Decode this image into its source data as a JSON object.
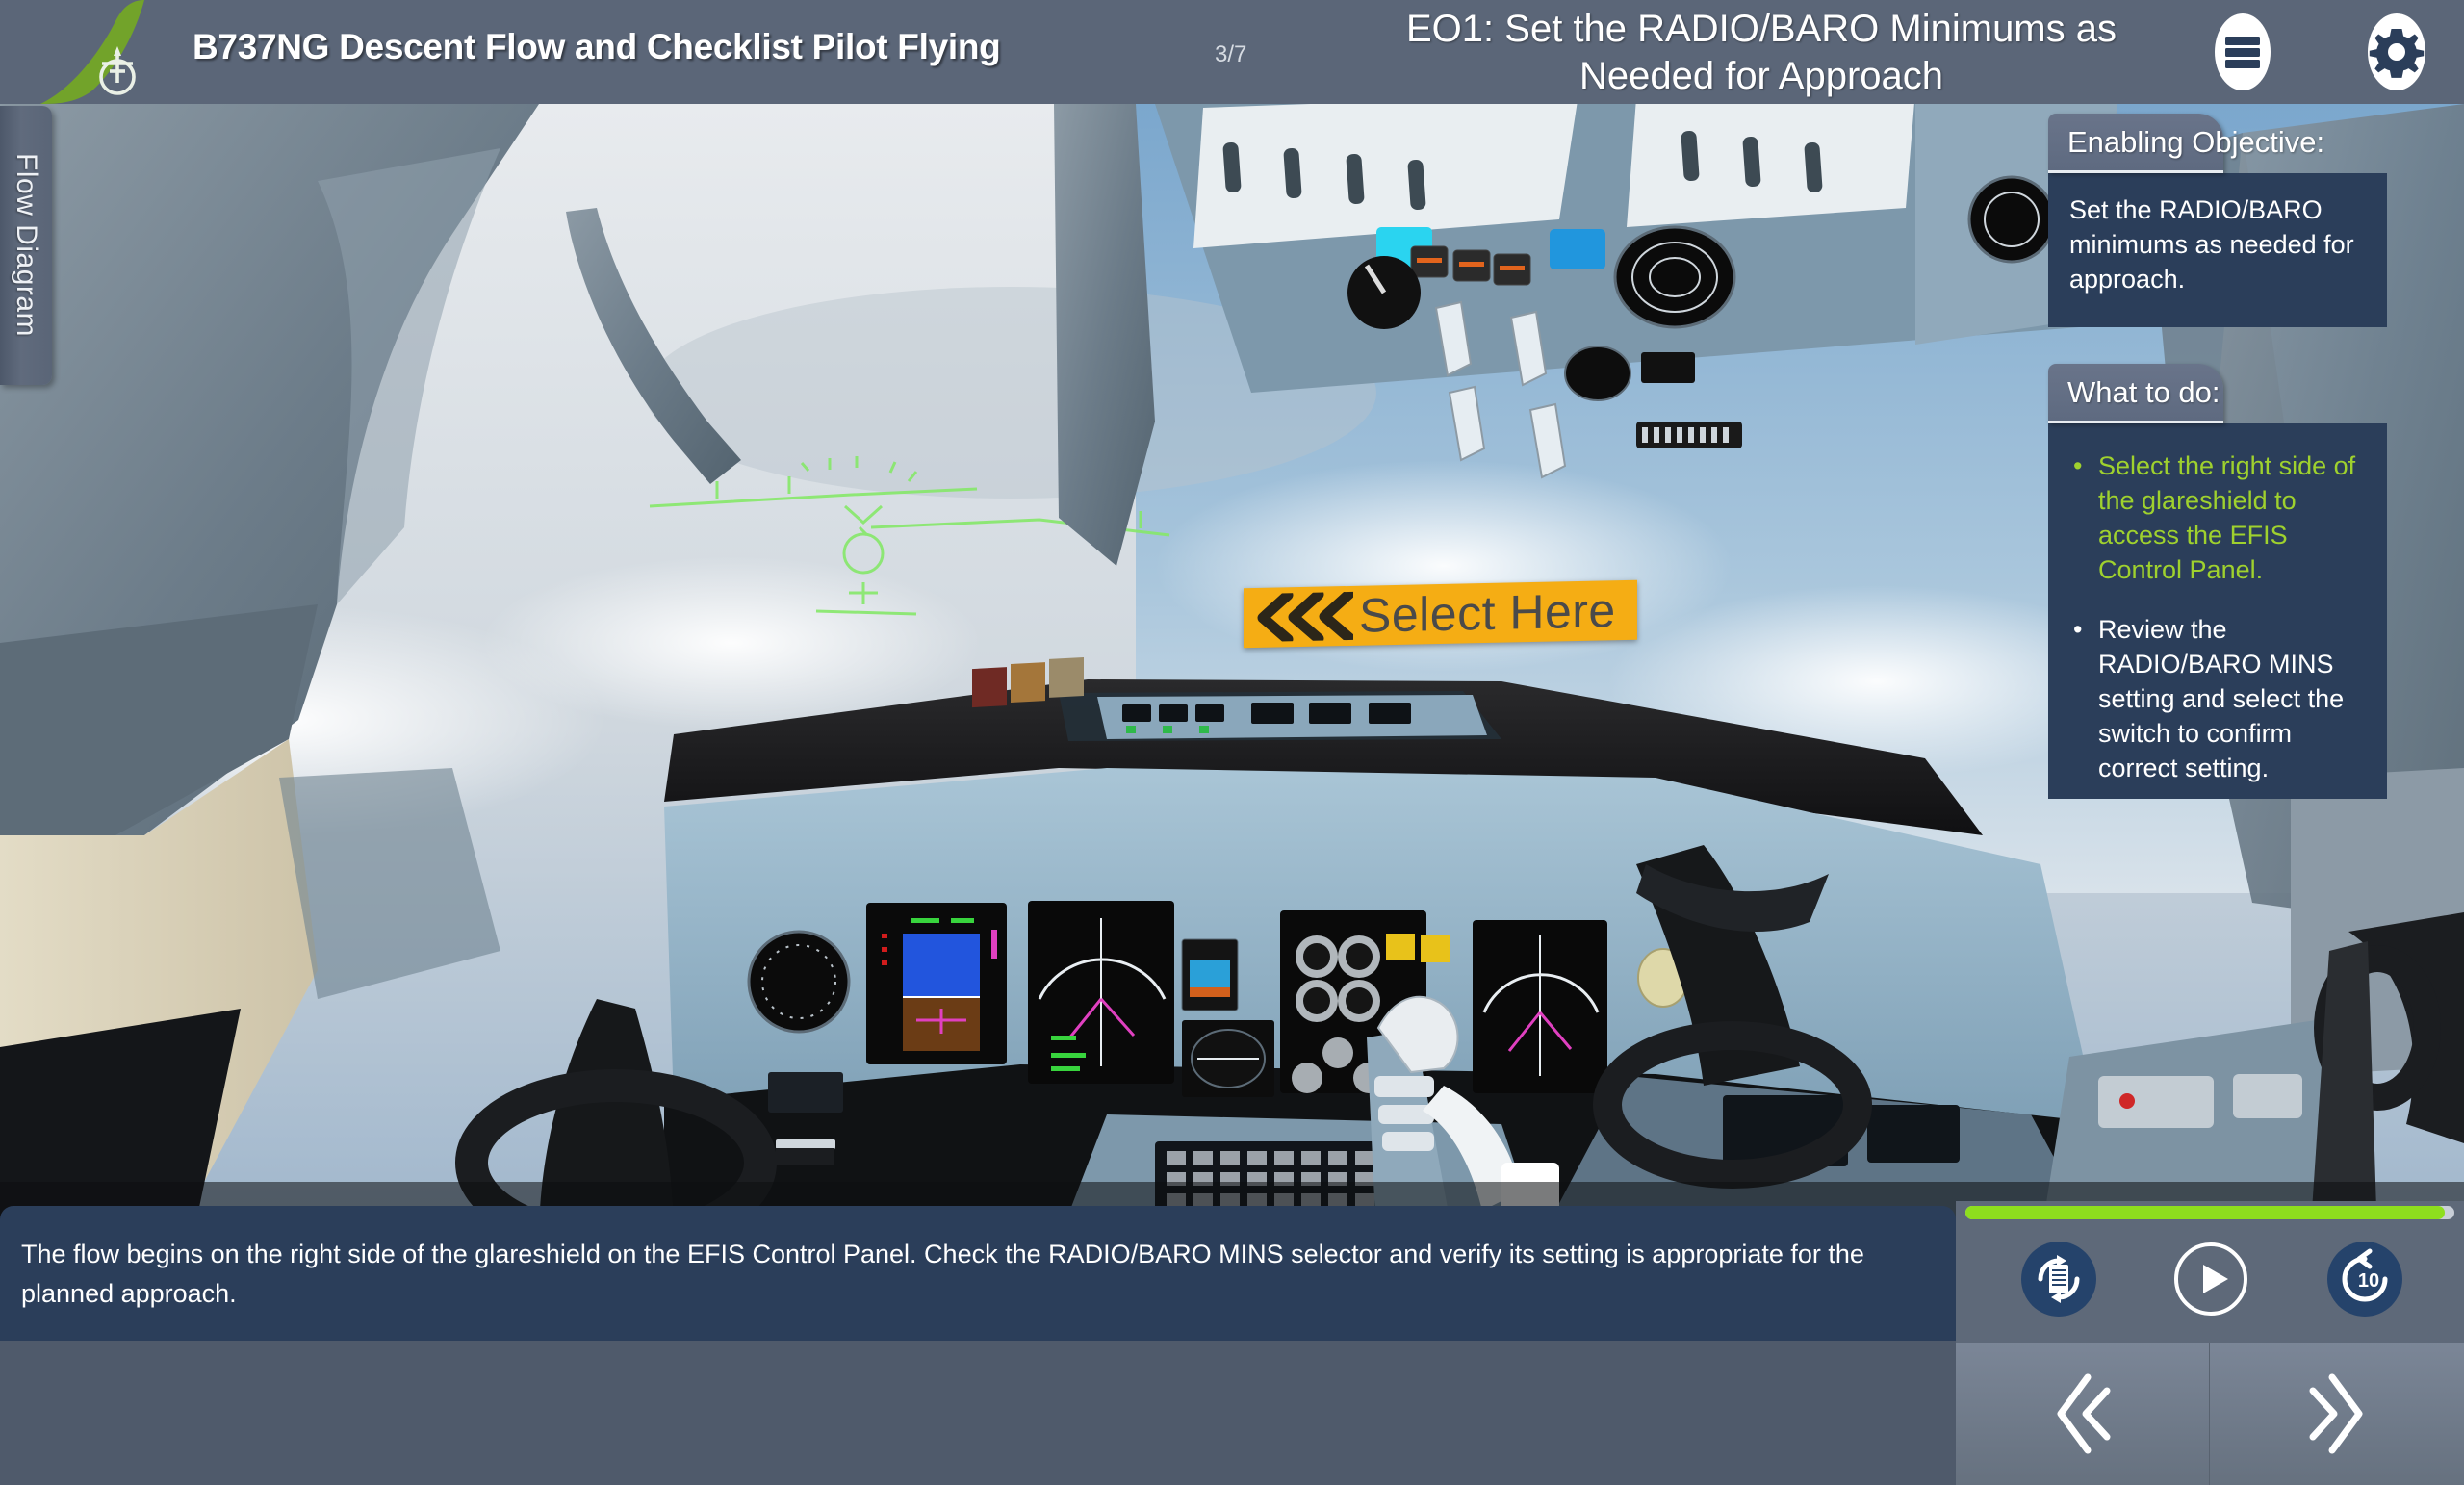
{
  "header": {
    "course_title": "B737NG Descent Flow and Checklist Pilot Flying",
    "page_count": "3/7",
    "eo_title": "EO1: Set the RADIO/BARO Minimums as Needed for Approach",
    "menu_icon": "hamburger-menu-icon",
    "settings_icon": "gear-icon",
    "logo_icon": "airline-tail-fin-logo"
  },
  "left_tab": {
    "label": "Flow Diagram"
  },
  "hotspot": {
    "label": "Select Here",
    "chevron_icon": "double-chevron-left-icon",
    "color": "#f5ad14"
  },
  "enabling_objective": {
    "tab_label": "Enabling Objective:",
    "text": "Set the RADIO/BARO minimums as needed for approach."
  },
  "what_to_do": {
    "tab_label": "What to do:",
    "items": [
      {
        "text": "Select the right side of the glareshield to access the EFIS Control Panel.",
        "state": "done",
        "color": "#9fd12e"
      },
      {
        "text": "Review the RADIO/BARO MINS setting and select the switch to confirm correct setting.",
        "state": "pending",
        "color": "#ffffff"
      }
    ]
  },
  "caption": {
    "text": "The flow begins on the right side of the glareshield on the EFIS Control Panel. Check the RADIO/BARO MINS selector and verify its setting is appropriate for the planned approach."
  },
  "player": {
    "progress_percent": 98,
    "progress_color": "#8ede1e",
    "controls": [
      {
        "name": "replay-slide-button",
        "icon": "replay-document-icon",
        "label": ""
      },
      {
        "name": "play-button",
        "icon": "play-icon",
        "label": ""
      },
      {
        "name": "rewind-10-button",
        "icon": "rewind-10-icon",
        "label": "10"
      }
    ]
  },
  "navigation": {
    "prev_icon": "double-chevron-left-icon",
    "next_icon": "double-chevron-right-icon"
  },
  "theme": {
    "header_bg": "#5b6678",
    "panel_bg": "#2b3e5a",
    "tab_bg": "#5e6a80",
    "accent_green": "#8ede1e",
    "accent_amber": "#f5ad14",
    "control_bar_bg": "#5e6979"
  }
}
